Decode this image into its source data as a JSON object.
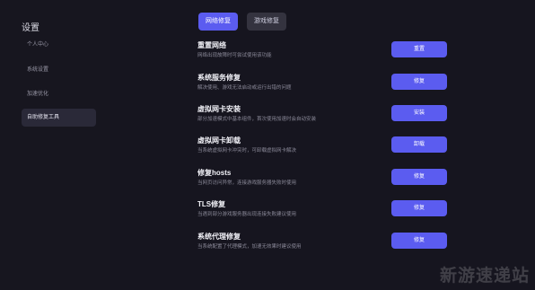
{
  "sidebar": {
    "title": "设置",
    "items": [
      {
        "label": "个人中心"
      },
      {
        "label": "系统设置"
      },
      {
        "label": "加速优化"
      },
      {
        "label": "自助修复工具"
      }
    ]
  },
  "tabs": [
    {
      "label": "网络修复"
    },
    {
      "label": "游戏修复"
    }
  ],
  "repairs": [
    {
      "title": "重置网络",
      "desc": "网络出现故障时可尝试使用该功能",
      "button": "重置"
    },
    {
      "title": "系统服务修复",
      "desc": "解决使用、游戏无法启动或运行出错的问题",
      "button": "修复"
    },
    {
      "title": "虚拟网卡安装",
      "desc": "部分加速模式中基本组件，首次使用加速时会自动安装",
      "button": "安装"
    },
    {
      "title": "虚拟网卡卸载",
      "desc": "当系统虚拟网卡冲突时，可卸载虚拟网卡解决",
      "button": "卸载"
    },
    {
      "title": "修复hosts",
      "desc": "当网页访问异常，连接游戏服务器失败时使用",
      "button": "修复"
    },
    {
      "title": "TLS修复",
      "desc": "当遇到部分游戏服务器出现连接失败建议使用",
      "button": "修复"
    },
    {
      "title": "系统代理修复",
      "desc": "当系统配置了代理模式，加速无效果时建议使用",
      "button": "修复"
    }
  ],
  "watermark": "新游速递站",
  "colors": {
    "accent": "#5b5cf0",
    "background": "#16151f"
  }
}
